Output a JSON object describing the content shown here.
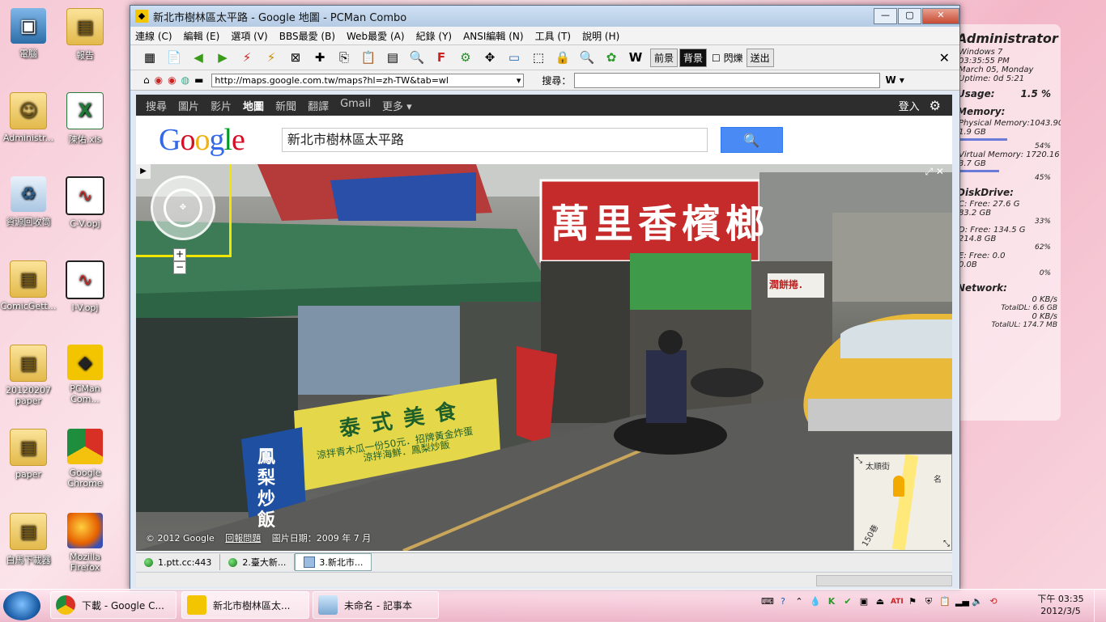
{
  "desktop": {
    "icons": [
      {
        "label": "電腦",
        "glyph": "▣",
        "kind": "pc"
      },
      {
        "label": "報告",
        "glyph": "▤",
        "kind": "folder"
      },
      {
        "label": "Administr...",
        "glyph": "☺",
        "kind": "folder"
      },
      {
        "label": "陳佑.xls",
        "glyph": "X",
        "kind": "xls"
      },
      {
        "label": "資源回收筒",
        "glyph": "♻",
        "kind": "bin"
      },
      {
        "label": "C-V.opj",
        "glyph": "∿",
        "kind": "opj"
      },
      {
        "label": "ComicGett...",
        "glyph": "▤",
        "kind": "folder"
      },
      {
        "label": "I-V.opj",
        "glyph": "∿",
        "kind": "opj"
      },
      {
        "label": "20120207 paper",
        "glyph": "▤",
        "kind": "folder"
      },
      {
        "label": "PCMan Com...",
        "glyph": "◆",
        "kind": "pcman"
      },
      {
        "label": "paper",
        "glyph": "▤",
        "kind": "folder"
      },
      {
        "label": "Google Chrome",
        "glyph": "",
        "kind": "chrome"
      },
      {
        "label": "白馬下載器",
        "glyph": "▤",
        "kind": "folder"
      },
      {
        "label": "Mozilla Firefox",
        "glyph": "",
        "kind": "firefox"
      }
    ]
  },
  "gadget": {
    "title": "Administrator",
    "os": "Windows 7",
    "time": "03:35:55 PM",
    "date": "March 05, Monday",
    "uptime": "Uptime: 0d 5:21",
    "cpu_label": "Usage:",
    "cpu_value": "1.5 %",
    "memory_label": "Memory:",
    "phys_mem": "Physical Memory:1043.90 M",
    "phys_total": "1.9 GB",
    "phys_pct": "54%",
    "virt_mem": "Virtual Memory: 1720.16 M",
    "virt_total": "3.7 GB",
    "virt_pct": "45%",
    "disk_label": "DiskDrive:",
    "c_drive": "C: Free: 27.6 G",
    "c_total": "83.2 GB",
    "c_pct": "33%",
    "d_drive": "D: Free: 134.5 G",
    "d_total": "214.8 GB",
    "d_pct": "62%",
    "e_drive": "E: Free: 0.0",
    "e_total": "0.0B",
    "e_pct": "0%",
    "net_label": "Network:",
    "down": "0 KB/s",
    "total_dl": "TotalDL: 6.6 GB",
    "up": "0 KB/s",
    "total_ul": "TotalUL: 174.7 MB"
  },
  "window": {
    "title": "新北市樹林區太平路 - Google 地圖 - PCMan Combo",
    "controls": {
      "min": "—",
      "max": "▢",
      "close": "✕"
    },
    "menu": [
      "連線 (C)",
      "編輯 (E)",
      "選項 (V)",
      "BBS最愛 (B)",
      "Web最愛 (A)",
      "紀錄 (Y)",
      "ANSI編輯 (N)",
      "工具 (T)",
      "說明 (H)"
    ],
    "toolbar": {
      "fg": "前景",
      "bg": "背景",
      "blink": "閃爍",
      "send": "送出",
      "close": "✕"
    },
    "address": "http://maps.google.com.tw/maps?hl=zh-TW&tab=wl",
    "search_label": "搜尋："
  },
  "google": {
    "bar": [
      "搜尋",
      "圖片",
      "影片",
      "地圖",
      "新聞",
      "翻譯",
      "Gmail",
      "更多 ▾"
    ],
    "active_index": 3,
    "login": "登入",
    "logo": "Google",
    "query": "新北市樹林區太平路",
    "search_icon": "🔍"
  },
  "streetview": {
    "sign_main": "萬里香檳榔",
    "sign_left": "泰式美食",
    "sign_left_sub1": "涼拌青木瓜一份50元．招牌黃金炸蛋",
    "sign_left_sub2": "涼拌海鮮．鳳梨炒飯",
    "sign_side": "鳳梨炒飯",
    "sign_small": "潤餅捲．",
    "copyright": "© 2012 Google",
    "report": "回報問題",
    "image_date": "圖片日期：2009 年 7 月",
    "minimap": {
      "street1": "太順街",
      "street2": "150巷",
      "street3": "名"
    }
  },
  "tabs": [
    {
      "label": "1.ptt.cc:443"
    },
    {
      "label": "2.臺大新..."
    },
    {
      "label": "3.新北市..."
    }
  ],
  "taskbar": {
    "items": [
      {
        "label": "下載 - Google C..."
      },
      {
        "label": "新北市樹林區太..."
      },
      {
        "label": "未命名 - 記事本"
      }
    ],
    "time": "下午 03:35",
    "date": "2012/3/5"
  }
}
